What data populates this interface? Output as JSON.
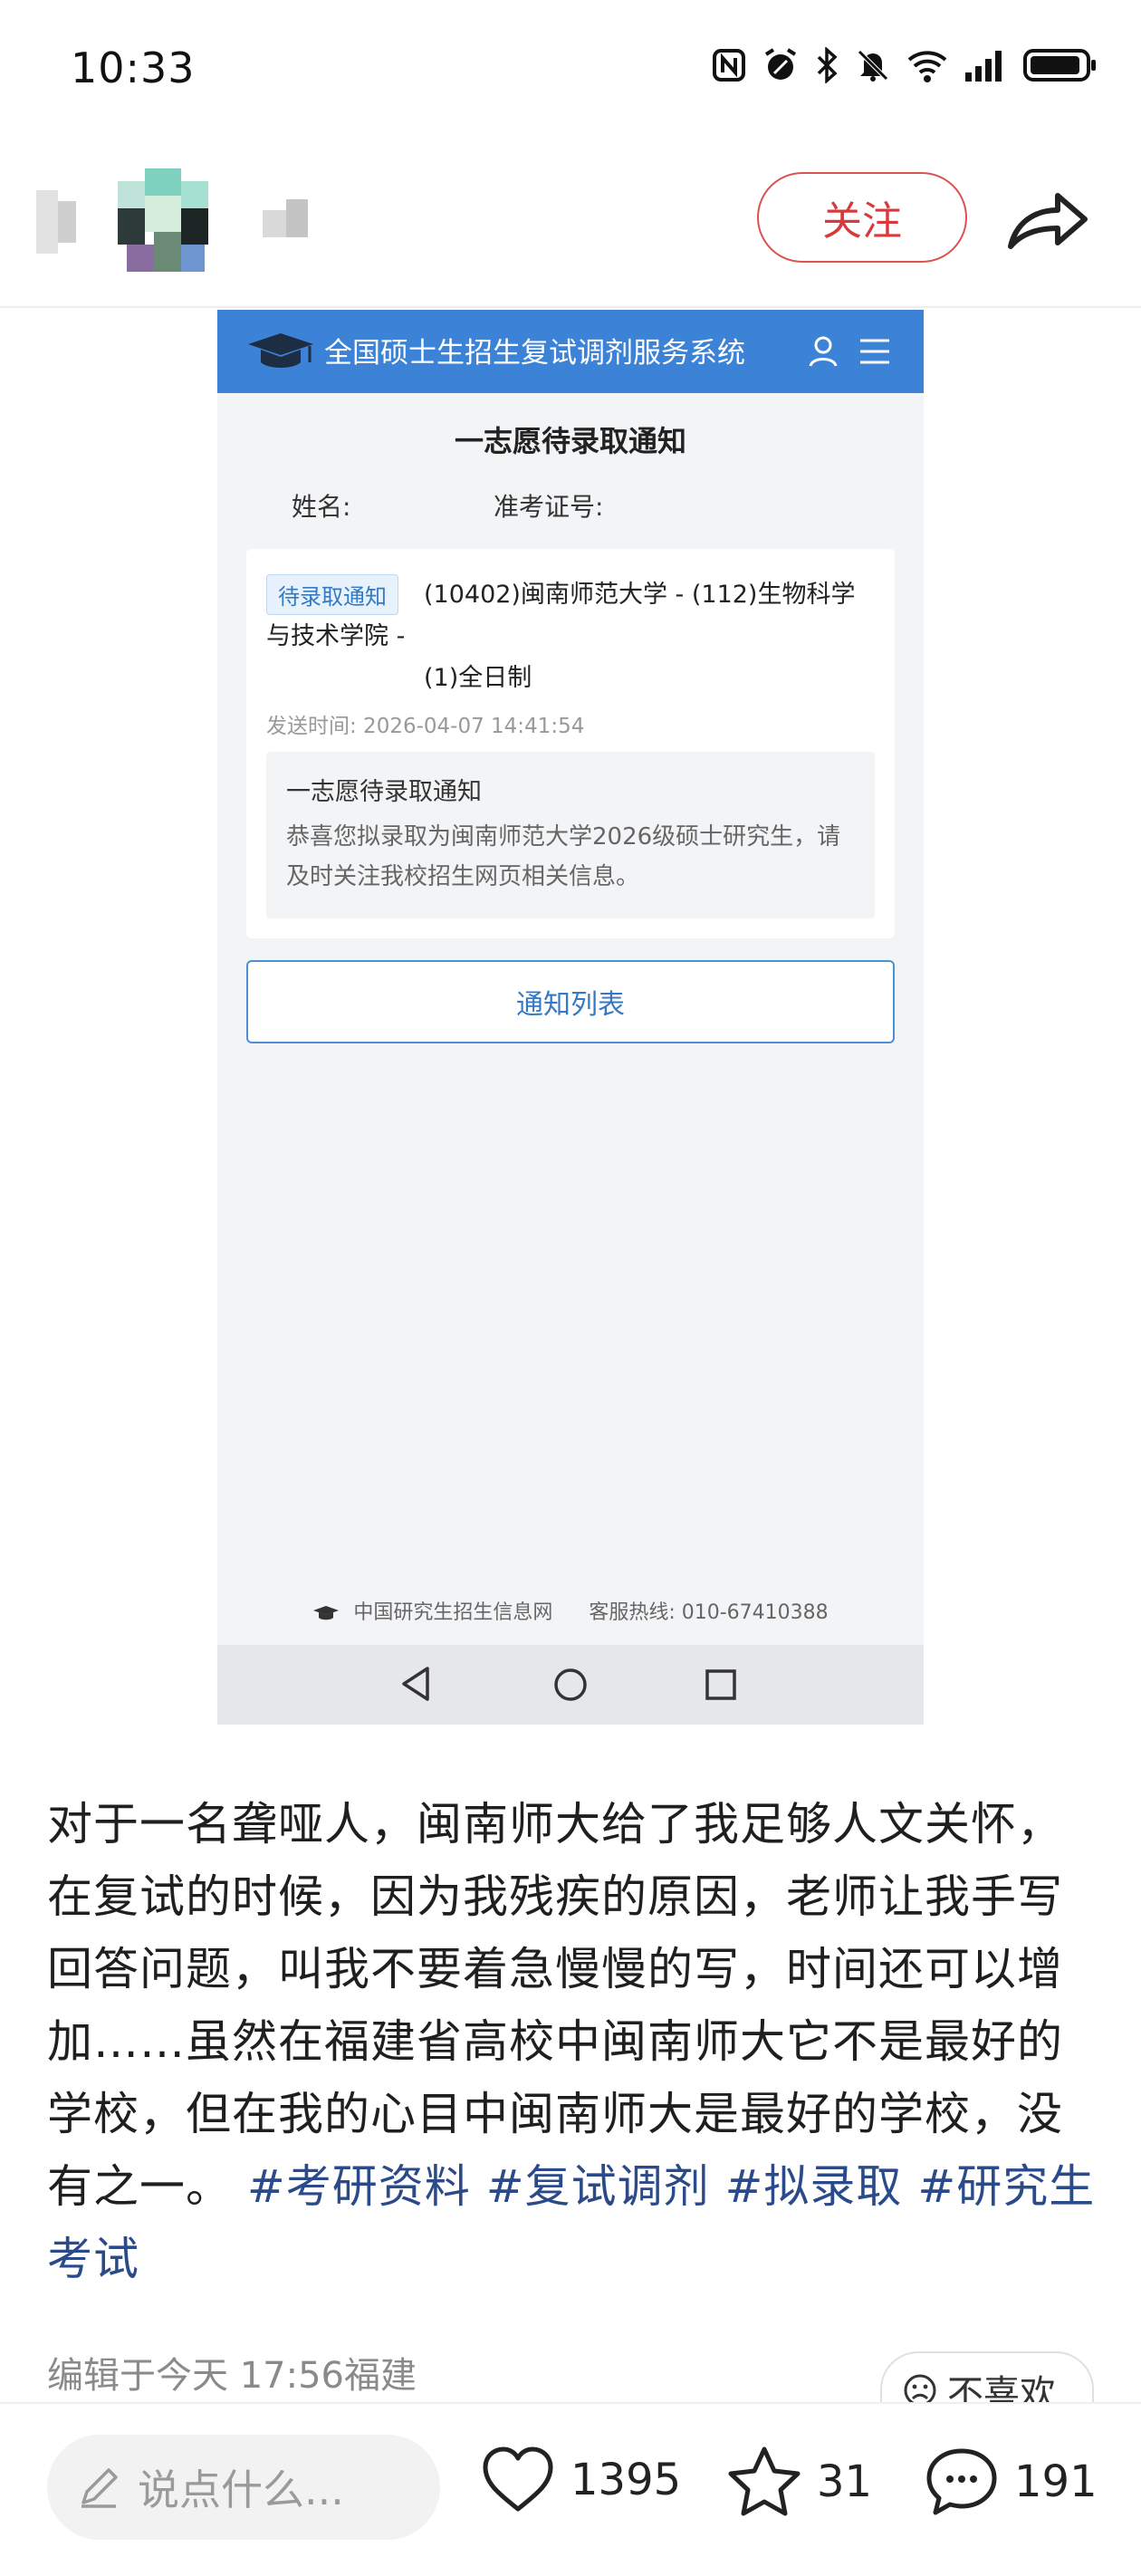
{
  "status_bar": {
    "time": "10:33",
    "icons": [
      "nfc-icon",
      "alarm-icon",
      "bluetooth-icon",
      "mute-icon",
      "wifi-icon",
      "signal-icon",
      "battery-icon"
    ]
  },
  "header": {
    "follow_label": "关注",
    "share_icon": "share-icon"
  },
  "embed": {
    "system_title": "全国硕士生招生复试调剂服务系统",
    "notice_heading": "一志愿待录取通知",
    "name_label": "姓名:",
    "exam_label": "准考证号:",
    "card": {
      "tag": "待录取通知",
      "line1": "(10402)闽南师范大学 - (112)生物科学",
      "line2": "与技术学院 -",
      "line3": "(1)全日制",
      "time": "发送时间:  2026-04-07 14:41:54",
      "inner_title": "一志愿待录取通知",
      "inner_body": "恭喜您拟录取为闽南师范大学2026级硕士研究生，请及时关注我校招生网页相关信息。"
    },
    "list_button": "通知列表",
    "footer_site": "中国研究生招生信息网",
    "footer_hotline": "客服热线:  010-67410388"
  },
  "post": {
    "text": "对于一名聋哑人，闽南师大给了我足够人文关怀，在复试的时候，因为我残疾的原因，老师让我手写回答问题，叫我不要着急慢慢的写，时间还可以增加……虽然在福建省高校中闽南师大它不是最好的学校，但在我的心目中闽南师大是最好的学校，没有之一。",
    "hashtags": [
      "#考研资料",
      "#复试调剂",
      "#拟录取",
      "#研究生考试"
    ],
    "edit_meta": "编辑于今天 17:56福建",
    "dislike_label": "不喜欢"
  },
  "bottom_bar": {
    "comment_placeholder": "说点什么...",
    "likes": "1395",
    "favorites": "31",
    "comments": "191"
  },
  "colors": {
    "accent_red": "#d9393a",
    "system_blue": "#3c82d6",
    "hashtag_blue": "#2a4a8a"
  }
}
